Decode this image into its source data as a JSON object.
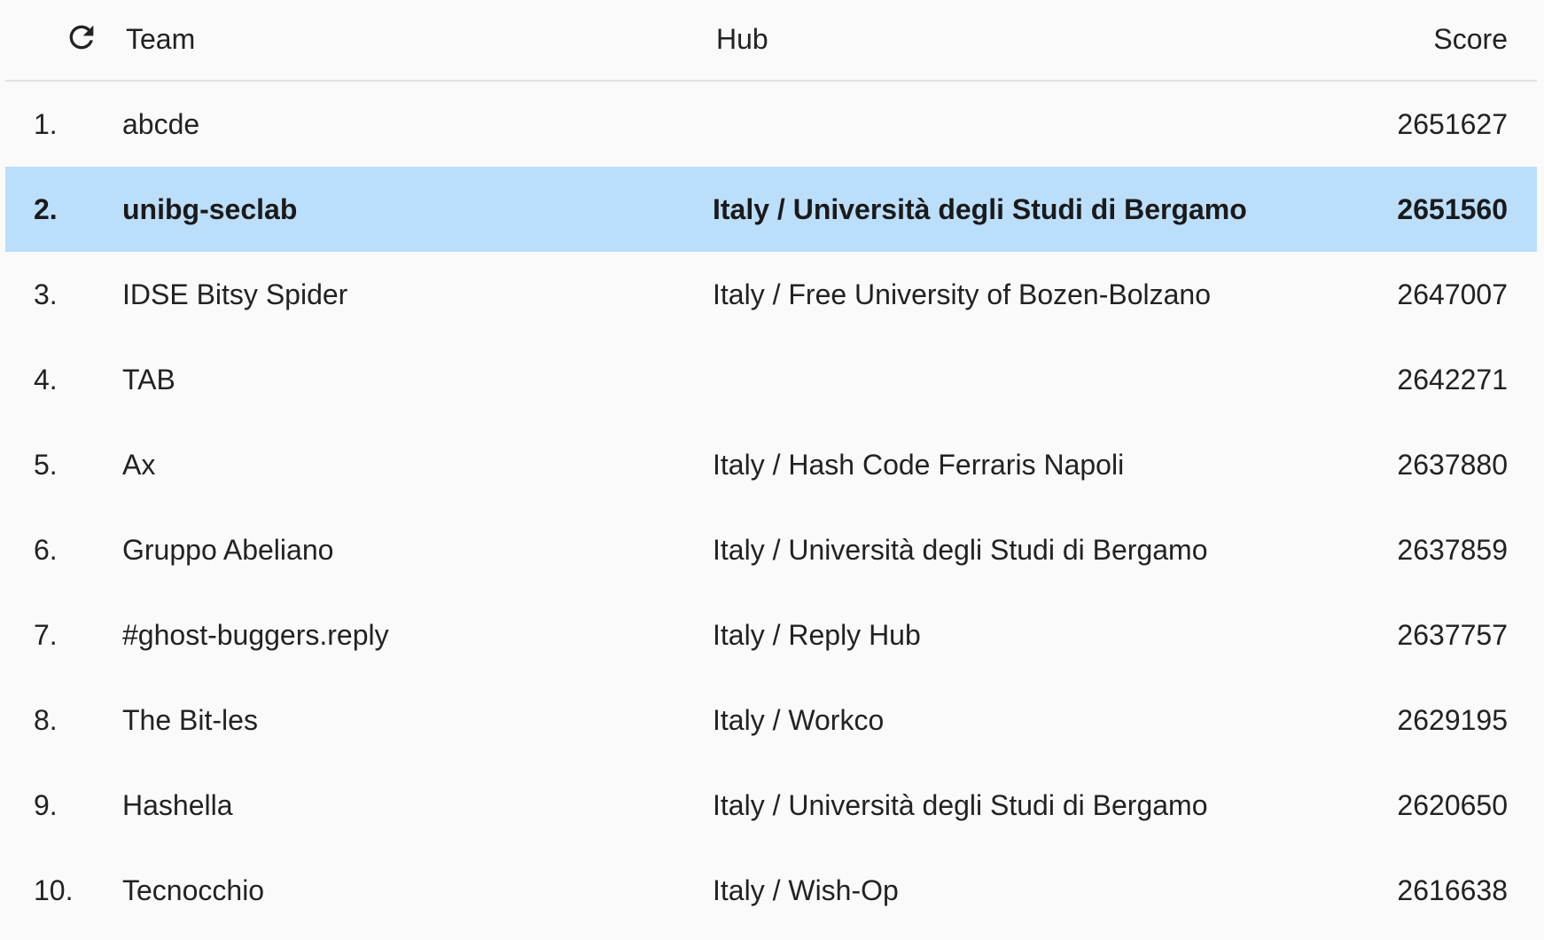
{
  "header": {
    "refresh_icon": "refresh-icon",
    "team_label": "Team",
    "hub_label": "Hub",
    "score_label": "Score"
  },
  "highlight_color": "#bbdefb",
  "rows": [
    {
      "rank": "1.",
      "team": "abcde",
      "hub": "",
      "score": "2651627",
      "highlighted": false
    },
    {
      "rank": "2.",
      "team": "unibg-seclab",
      "hub": "Italy / Università degli Studi di Bergamo",
      "score": "2651560",
      "highlighted": true
    },
    {
      "rank": "3.",
      "team": "IDSE Bitsy Spider",
      "hub": "Italy / Free University of Bozen-Bolzano",
      "score": "2647007",
      "highlighted": false
    },
    {
      "rank": "4.",
      "team": "TAB",
      "hub": "",
      "score": "2642271",
      "highlighted": false
    },
    {
      "rank": "5.",
      "team": "Ax",
      "hub": "Italy / Hash Code Ferraris Napoli",
      "score": "2637880",
      "highlighted": false
    },
    {
      "rank": "6.",
      "team": "Gruppo Abeliano",
      "hub": "Italy / Università degli Studi di Bergamo",
      "score": "2637859",
      "highlighted": false
    },
    {
      "rank": "7.",
      "team": "#ghost-buggers.reply",
      "hub": "Italy / Reply Hub",
      "score": "2637757",
      "highlighted": false
    },
    {
      "rank": "8.",
      "team": "The Bit-les",
      "hub": "Italy / Workco",
      "score": "2629195",
      "highlighted": false
    },
    {
      "rank": "9.",
      "team": "Hashella",
      "hub": "Italy / Università degli Studi di Bergamo",
      "score": "2620650",
      "highlighted": false
    },
    {
      "rank": "10.",
      "team": "Tecnocchio",
      "hub": "Italy / Wish-Op",
      "score": "2616638",
      "highlighted": false
    }
  ]
}
